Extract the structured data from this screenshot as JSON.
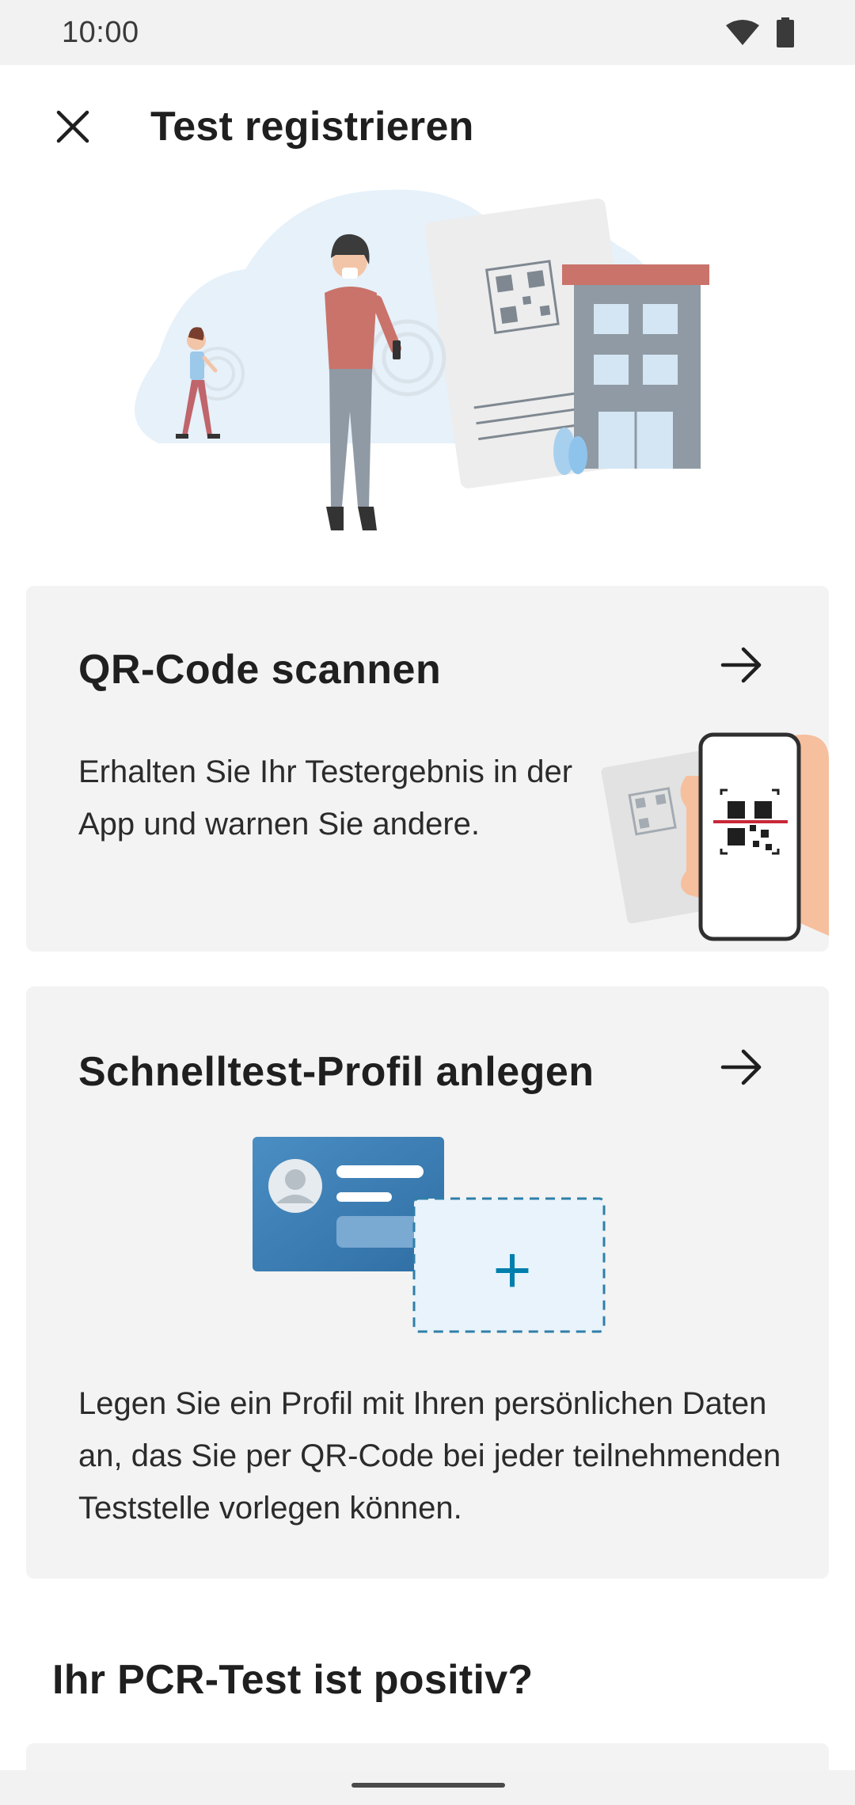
{
  "status_bar": {
    "time": "10:00",
    "icons": [
      "wifi-icon",
      "battery-icon"
    ]
  },
  "app_bar": {
    "title": "Test registrieren",
    "close_icon": "close-icon"
  },
  "cards": {
    "qr_scan": {
      "title": "QR-Code scannen",
      "body": "Erhalten Sie Ihr Testergebnis in der App und warnen Sie andere.",
      "arrow_icon": "arrow-right-icon"
    },
    "rapid_test_profile": {
      "title": "Schnelltest-Profil anlegen",
      "body": "Legen Sie ein Profil mit Ihren persönlichen Daten an, das Sie per QR-Code bei jeder teilnehmenden Teststelle vorlegen können.",
      "arrow_icon": "arrow-right-icon",
      "add_icon": "+"
    }
  },
  "section": {
    "pcr_heading": "Ihr PCR-Test ist positiv?"
  },
  "colors": {
    "accent": "#007fad",
    "card_background": "#f3f3f3",
    "status_bar": "#f2f2f2",
    "text_primary": "#1f1f1f"
  }
}
